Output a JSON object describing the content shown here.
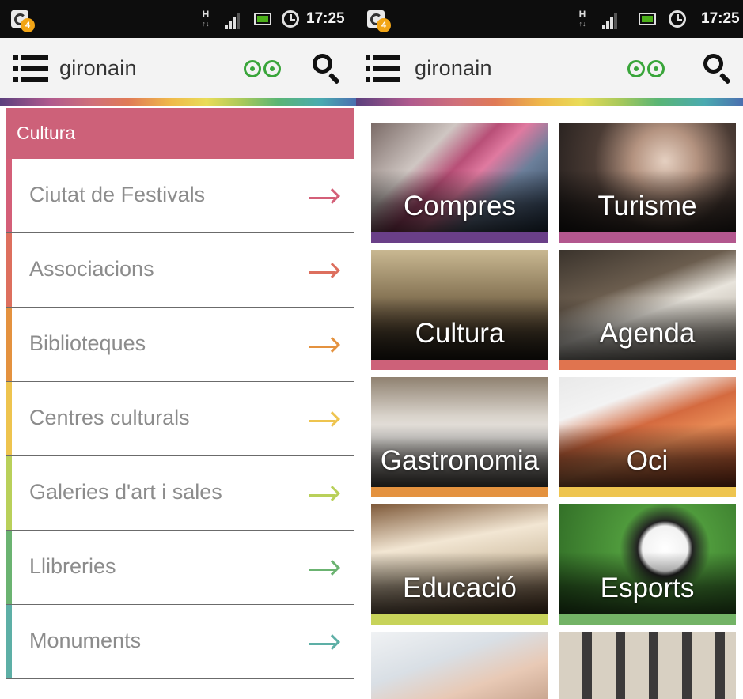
{
  "status_bar": {
    "notification_count": "4",
    "data_indicator": "H",
    "time": "17:25"
  },
  "app_bar": {
    "title": "gironain"
  },
  "left_screen": {
    "category_title": "Cultura",
    "items": [
      {
        "label": "Ciutat de Festivals",
        "color": "#d45f78"
      },
      {
        "label": "Associacions",
        "color": "#dd6f5e"
      },
      {
        "label": "Biblioteques",
        "color": "#e4923f"
      },
      {
        "label": "Centres culturals",
        "color": "#eec44f"
      },
      {
        "label": "Galeries d'art i sales",
        "color": "#b9d05a"
      },
      {
        "label": "Llibreries",
        "color": "#6bb371"
      },
      {
        "label": "Monuments",
        "color": "#5dafa6"
      }
    ]
  },
  "right_screen": {
    "tiles": [
      {
        "label": "Compres",
        "bar_color": "#6a3f88",
        "photo": "shopping-photo"
      },
      {
        "label": "Turisme",
        "bar_color": "#b3578e",
        "photo": "tourists-photo"
      },
      {
        "label": "Cultura",
        "bar_color": "#cd6179",
        "photo": "cloister-photo"
      },
      {
        "label": "Agenda",
        "bar_color": "#e0744f",
        "photo": "calendar-photo"
      },
      {
        "label": "Gastronomia",
        "bar_color": "#e4923f",
        "photo": "restaurant-photo"
      },
      {
        "label": "Oci",
        "bar_color": "#eec44f",
        "photo": "ticket-photo"
      },
      {
        "label": "Educació",
        "bar_color": "#c7d35a",
        "photo": "book-photo"
      },
      {
        "label": "Esports",
        "bar_color": "#73b366",
        "photo": "football-photo"
      },
      {
        "label": "",
        "bar_color": "#5dafa6",
        "photo": "health-photo"
      },
      {
        "label": "",
        "bar_color": "#4b6fb0",
        "photo": "building-photo"
      }
    ]
  },
  "colors": {
    "accent_pink": "#cd6179",
    "icon_green": "#39a53a"
  }
}
